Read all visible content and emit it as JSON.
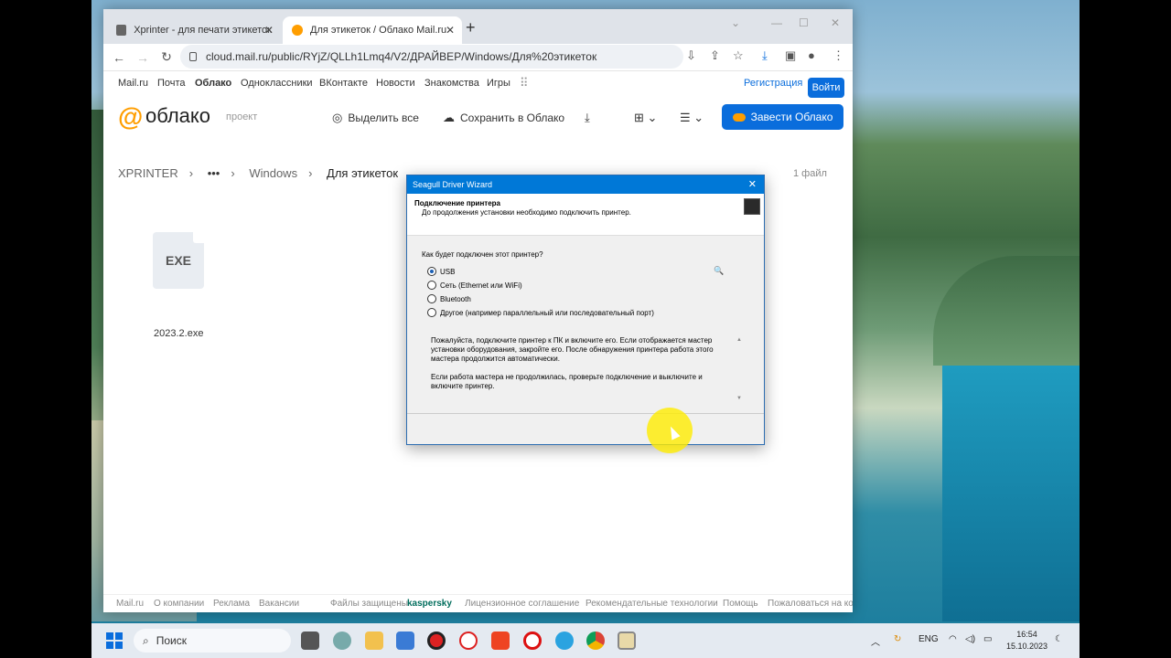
{
  "browser": {
    "tabs": [
      {
        "label": "Xprinter - для печати этикеток"
      },
      {
        "label": "Для этикеток / Облако Mail.ru"
      }
    ],
    "url": "cloud.mail.ru/public/RYjZ/QLLh1Lmq4/V2/ДРАЙВЕР/Windows/Для%20этикеток"
  },
  "mailnav": {
    "items": [
      "Mail.ru",
      "Почта",
      "Облако",
      "Одноклассники",
      "ВКонтакте",
      "Новости",
      "Знакомства",
      "Игры"
    ],
    "register": "Регистрация",
    "login": "Войти"
  },
  "cloud": {
    "logo": "облако",
    "project": "проект",
    "select_all": "Выделить все",
    "save": "Сохранить в Облако",
    "create": "Завести Облако",
    "breadcrumbs": [
      "XPRINTER",
      "•••",
      "Windows",
      "Для этикеток"
    ],
    "file_count": "1 файл",
    "file": {
      "badge": "EXE",
      "name": "2023.2.exe"
    }
  },
  "footer": {
    "links": [
      "Mail.ru",
      "О компании",
      "Реклама",
      "Вакансии"
    ],
    "protected": "Файлы защищены",
    "kaspersky": "kaspersky",
    "right": [
      "Лицензионное соглашение",
      "Рекомендательные технологии",
      "Помощь",
      "Пожаловаться на кон"
    ]
  },
  "dialog": {
    "title": "Seagull Driver Wizard",
    "heading": "Подключение принтера",
    "subheading": "До продолжения установки необходимо подключить принтер.",
    "question": "Как будет подключен этот принтер?",
    "options": [
      {
        "label": "USB",
        "selected": true
      },
      {
        "label": "Сеть (Ethernet или WiFi)",
        "selected": false
      },
      {
        "label": "Bluetooth",
        "selected": false
      },
      {
        "label": "Другое (например параллельный или последовательный порт)",
        "selected": false
      }
    ],
    "info1": "Пожалуйста, подключите принтер к ПК и включите его. Если отображается мастер установки оборудования, закройте его. После обнаружения принтера работа этого мастера продолжится автоматически.",
    "info2": "Если работа мастера не продолжилась, проверьте подключение и выключите и включите принтер."
  },
  "taskbar": {
    "search": "Поиск",
    "lang": "ENG",
    "time": "16:54",
    "date": "15.10.2023"
  }
}
